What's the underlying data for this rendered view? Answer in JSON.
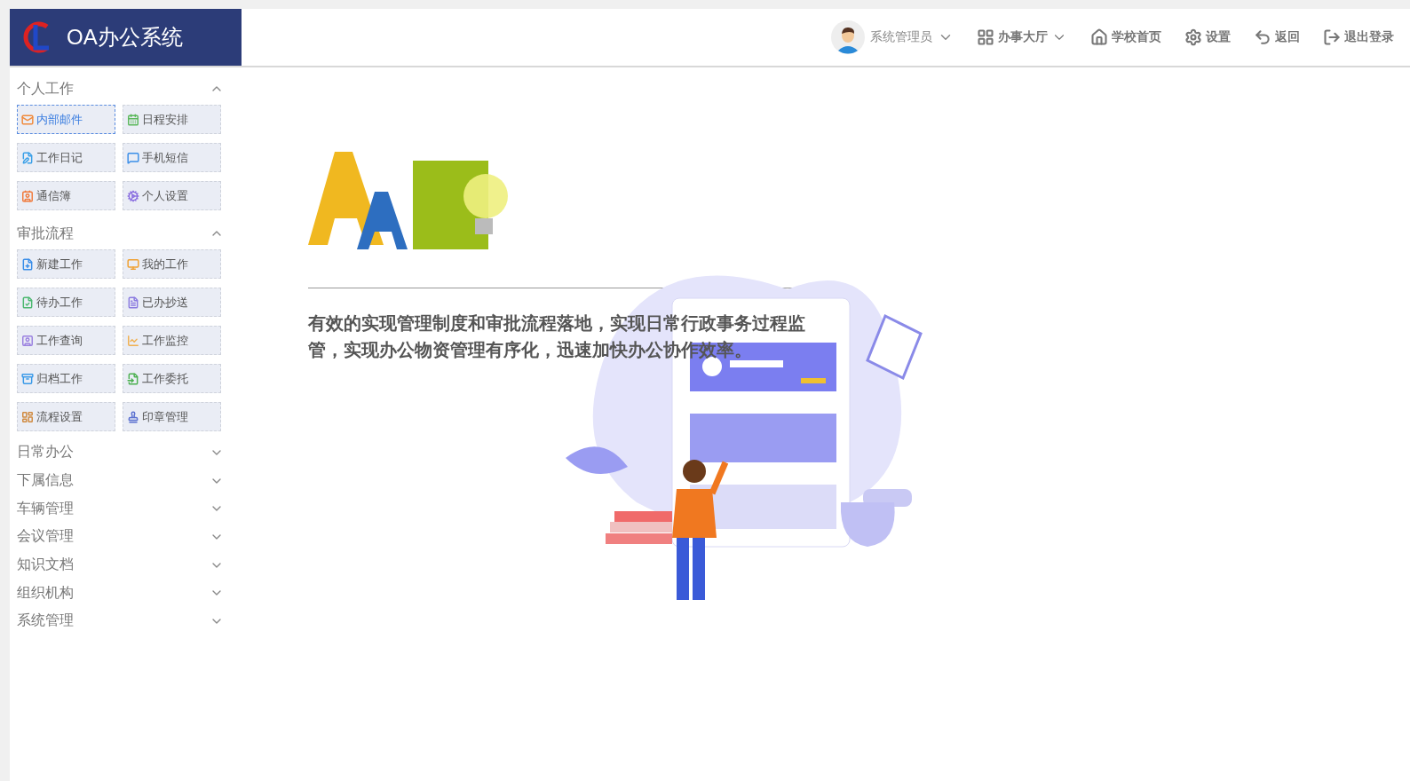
{
  "app": {
    "title": "OA办公系统"
  },
  "header": {
    "user": {
      "name": "系统管理员"
    },
    "nav": [
      {
        "kind": "dropdown",
        "label": "办事大厅"
      },
      {
        "kind": "link",
        "label": "学校首页"
      },
      {
        "kind": "link",
        "label": "设置"
      },
      {
        "kind": "link",
        "label": "返回"
      },
      {
        "kind": "link",
        "label": "退出登录"
      }
    ]
  },
  "sidebar": {
    "sections": [
      {
        "title": "个人工作",
        "expanded": true,
        "items": [
          {
            "label": "内部邮件",
            "selected": true
          },
          {
            "label": "日程安排",
            "selected": false
          },
          {
            "label": "工作日记",
            "selected": false
          },
          {
            "label": "手机短信",
            "selected": false
          },
          {
            "label": "通信簿",
            "selected": false
          },
          {
            "label": "个人设置",
            "selected": false
          }
        ]
      },
      {
        "title": "审批流程",
        "expanded": true,
        "items": [
          {
            "label": "新建工作",
            "selected": false
          },
          {
            "label": "我的工作",
            "selected": false
          },
          {
            "label": "待办工作",
            "selected": false
          },
          {
            "label": "已办抄送",
            "selected": false
          },
          {
            "label": "工作查询",
            "selected": false
          },
          {
            "label": "工作监控",
            "selected": false
          },
          {
            "label": "归档工作",
            "selected": false
          },
          {
            "label": "工作委托",
            "selected": false
          },
          {
            "label": "流程设置",
            "selected": false
          },
          {
            "label": "印章管理",
            "selected": false
          }
        ]
      },
      {
        "title": "日常办公",
        "expanded": false
      },
      {
        "title": "下属信息",
        "expanded": false
      },
      {
        "title": "车辆管理",
        "expanded": false
      },
      {
        "title": "会议管理",
        "expanded": false
      },
      {
        "title": "知识文档",
        "expanded": false
      },
      {
        "title": "组织机构",
        "expanded": false
      },
      {
        "title": "系统管理",
        "expanded": false
      }
    ]
  },
  "main": {
    "intro": "有效的实现管理制度和审批流程落地，实现日常行政事务过程监管，实现办公物资管理有序化，迅速加快办公协作效率。"
  }
}
